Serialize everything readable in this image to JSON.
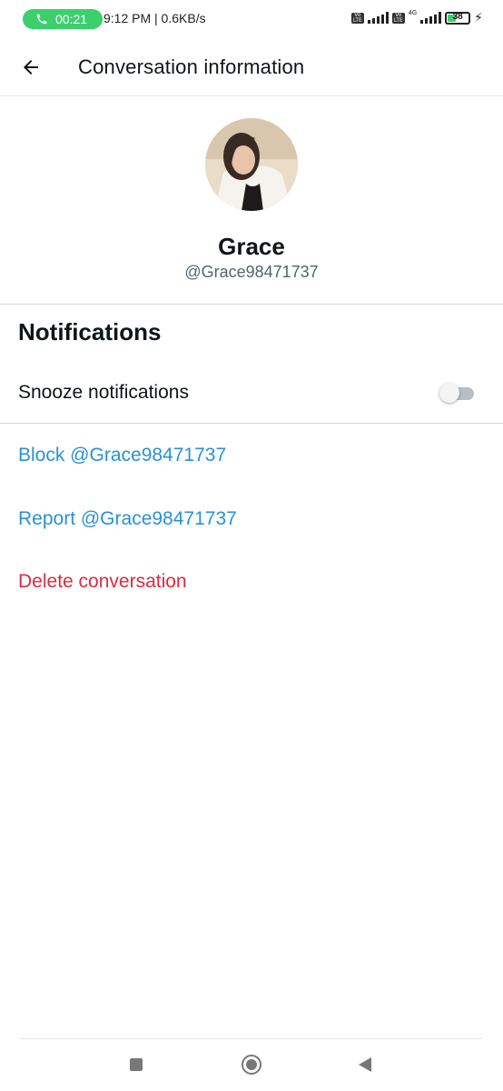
{
  "status_bar": {
    "call_timer": "00:21",
    "time_speed": "9:12 PM | 0.6KB/s",
    "network_badge_1": "Vo LTE",
    "network_badge_2": "Vo LTE",
    "network_type": "4G",
    "battery_level": "38",
    "icons": [
      "phone-icon",
      "volte-icon",
      "signal-icon",
      "volte-icon",
      "signal-icon",
      "battery-icon",
      "charging-icon"
    ],
    "call_pill_color": "#3ccf6e"
  },
  "header": {
    "title": "Conversation information",
    "back_icon": "arrow-left-icon"
  },
  "profile": {
    "name": "Grace",
    "handle": "@Grace98471737",
    "avatar": "profile-photo"
  },
  "notifications": {
    "section_title": "Notifications",
    "snooze_label": "Snooze notifications",
    "snooze_enabled": false
  },
  "actions": {
    "block_label": "Block @Grace98471737",
    "report_label": "Report @Grace98471737",
    "delete_label": "Delete conversation",
    "link_color": "#2a92d0",
    "danger_color": "#d92d3f"
  },
  "navigation_bar": {
    "icons": [
      "recents-square-icon",
      "home-circle-icon",
      "back-triangle-icon"
    ]
  }
}
